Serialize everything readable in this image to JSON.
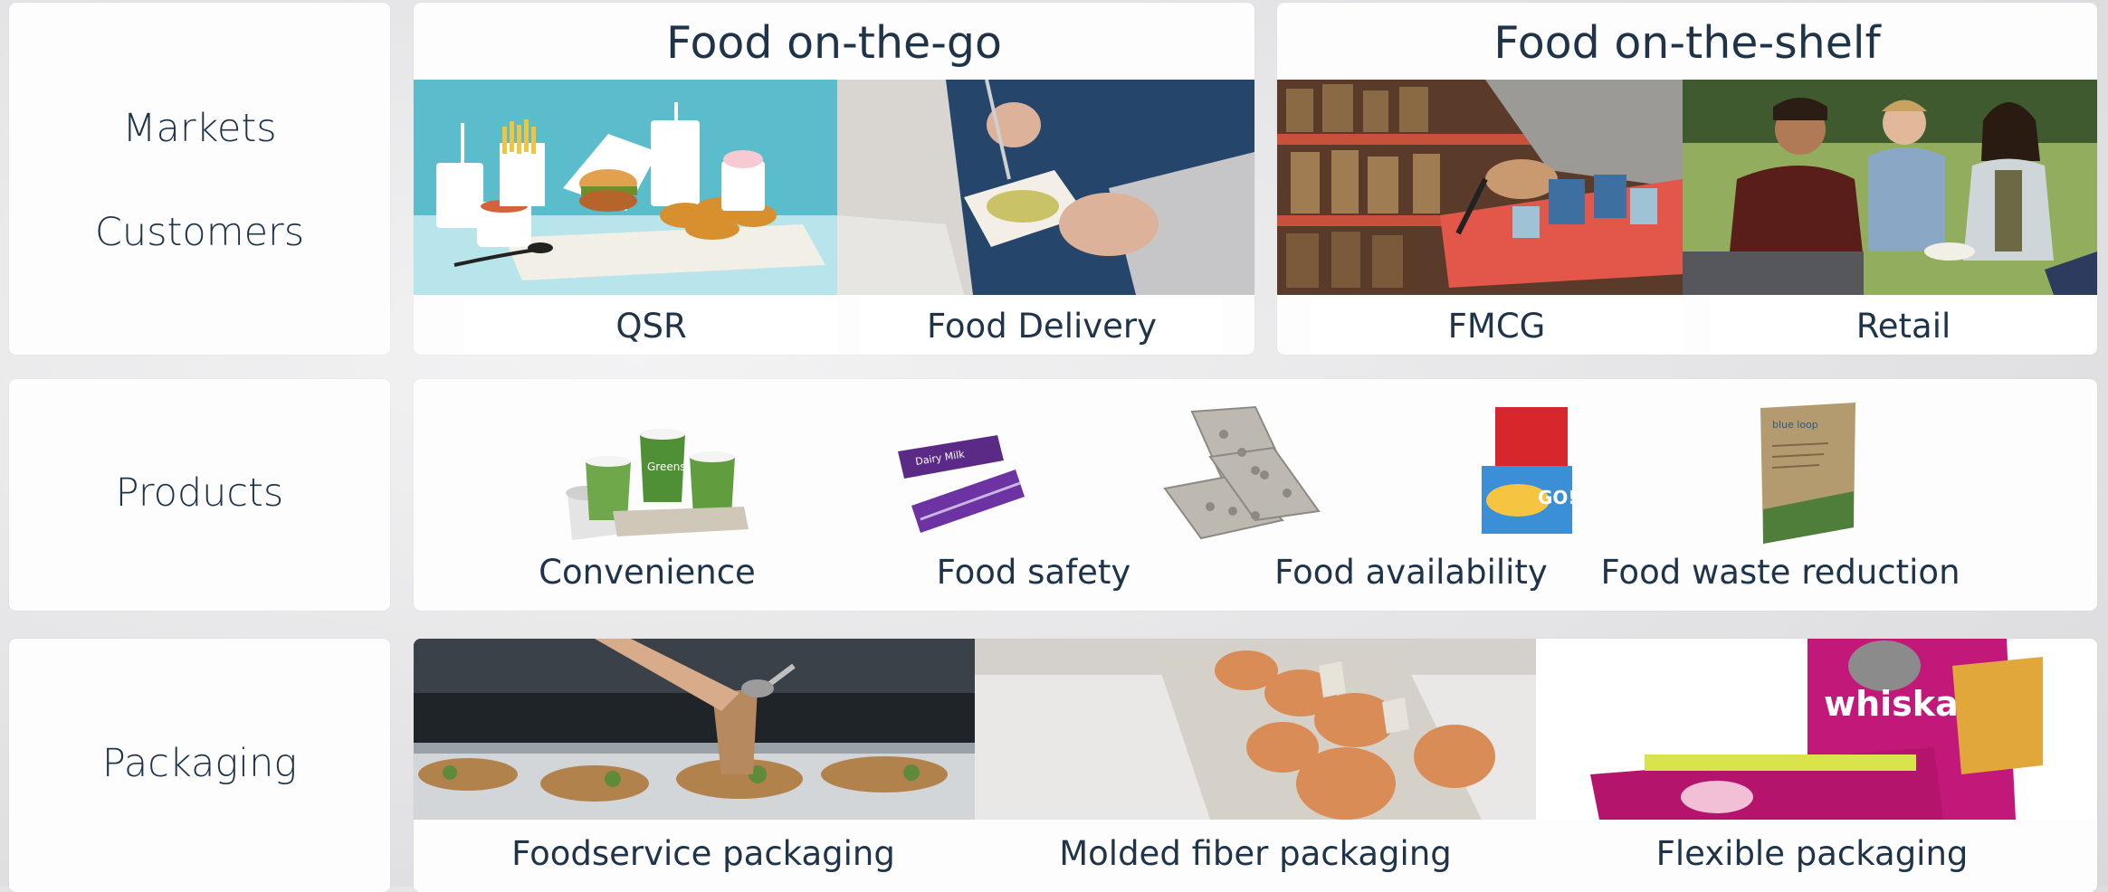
{
  "labels": {
    "markets": "Markets",
    "customers": "Customers",
    "products": "Products",
    "packaging": "Packaging"
  },
  "segments": {
    "on_the_go": {
      "title": "Food on-the-go",
      "items": [
        {
          "label": "QSR",
          "image": "fast-food-tray-photo"
        },
        {
          "label": "Food Delivery",
          "image": "food-delivery-photo"
        }
      ]
    },
    "on_the_shelf": {
      "title": "Food on-the-shelf",
      "items": [
        {
          "label": "FMCG",
          "image": "supermarket-shelf-photo"
        },
        {
          "label": "Retail",
          "image": "picnic-people-photo"
        }
      ]
    }
  },
  "products": [
    {
      "label": "Convenience",
      "image": "green-cups-carrier-photo"
    },
    {
      "label": "Food safety",
      "image": "chocolate-bar-wrappers-photo"
    },
    {
      "label": "Food availability",
      "image": "egg-trays-stack-photo"
    },
    {
      "label": "Food waste reduction",
      "image": "paper-pouch-photo"
    }
  ],
  "product_image_text": {
    "cup_brand": "Greens",
    "chocolate_brand": "Dairy Milk",
    "snack_brand": "GO!",
    "pouch_brand": "blue loop"
  },
  "packaging": [
    {
      "label": "Foodservice packaging",
      "image": "salad-bar-cup-photo"
    },
    {
      "label": "Molded fiber packaging",
      "image": "egg-carton-photo"
    },
    {
      "label": "Flexible packaging",
      "image": "pet-food-bags-photo"
    }
  ],
  "packaging_image_text": {
    "pet_food_brand": "whiskas"
  },
  "colors": {
    "text": "#1f3349",
    "panel": "#fdfdfd",
    "qsr_background": "#5bbccb",
    "chocolate_purple": "#5b2a86",
    "pet_food_magenta": "#c2187a"
  }
}
